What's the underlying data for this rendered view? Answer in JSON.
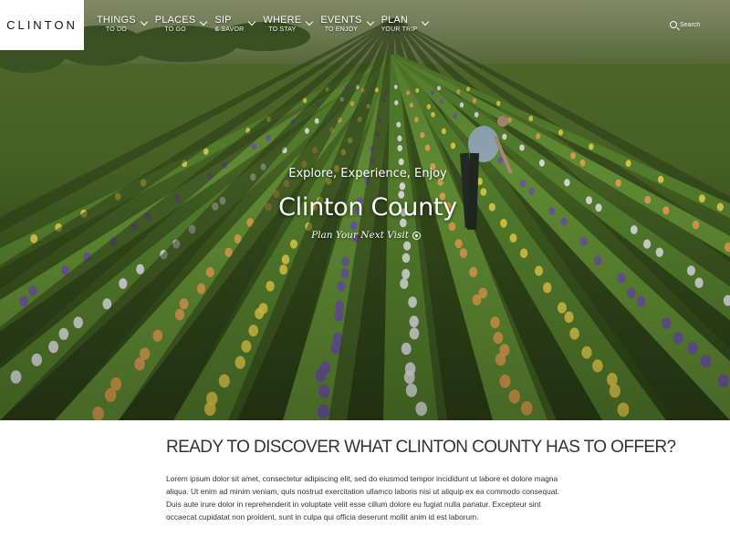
{
  "brand": {
    "name": "CLINTON"
  },
  "nav": {
    "items": [
      {
        "label": "THINGS",
        "sub": "TO DO"
      },
      {
        "label": "PLACES",
        "sub": "TO GO"
      },
      {
        "label": "SIP",
        "sub": "& SAVOR"
      },
      {
        "label": "WHERE",
        "sub": "TO STAY"
      },
      {
        "label": "EVENTS",
        "sub": "TO ENJOY"
      },
      {
        "label": "PLAN",
        "sub": "YOUR TRIP"
      }
    ],
    "search_placeholder": "Search"
  },
  "hero": {
    "tagline": "Explore, Experience, Enjoy",
    "title": "Clinton County",
    "cta_label": "Plan Your Next Visit"
  },
  "content": {
    "heading": "READY TO DISCOVER WHAT CLINTON COUNTY HAS TO OFFER?",
    "body": "Lorem ipsum dolor sit amet, consectetur adipiscing elit, sed do eiusmod tempor incididunt ut labore et dolore magna aliqua. Ut enim ad minim veniam, quis nostrud exercitation ullamco laboris nisi ut aliquip ex ea commodo consequat. Duis aute irure dolor in reprehenderit in voluptate velit esse cillum dolore eu fugiat nulla pariatur. Excepteur sint occaecat cupidatat non proident, sunt in culpa qui officia deserunt mollit anim id est laborum."
  },
  "colors": {
    "text": "#333333",
    "hero_overlay_text": "#ffffff",
    "flower_yellow": "#e9d04a",
    "flower_purple": "#6c4fa8",
    "flower_white": "#e9e6f0",
    "flower_orange": "#e8a050"
  }
}
